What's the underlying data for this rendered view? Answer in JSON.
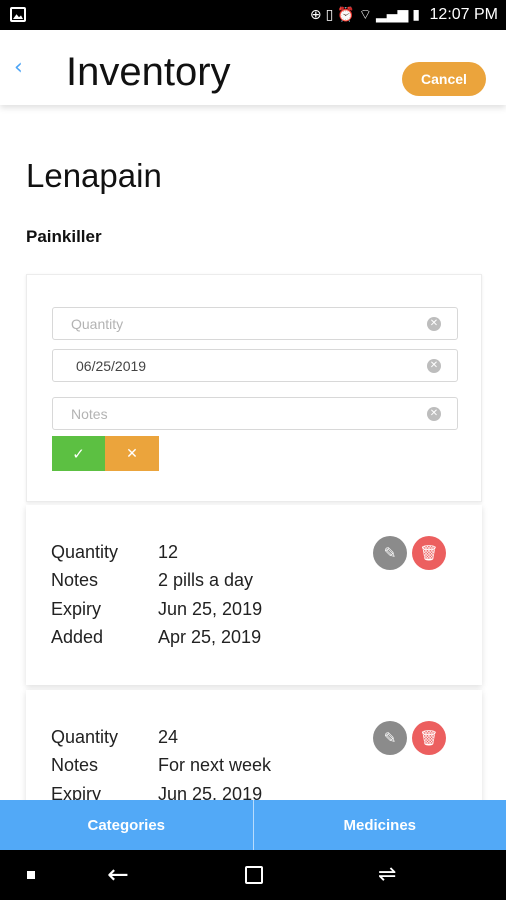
{
  "status_bar": {
    "time": "12:07 PM"
  },
  "header": {
    "title": "Inventory",
    "cancel_label": "Cancel"
  },
  "medicine": {
    "name": "Lenapain",
    "category": "Painkiller"
  },
  "form": {
    "quantity_placeholder": "Quantity",
    "date_value": "06/25/2019",
    "notes_placeholder": "Notes"
  },
  "labels": {
    "quantity": "Quantity",
    "notes": "Notes",
    "expiry": "Expiry",
    "added": "Added"
  },
  "entries": [
    {
      "quantity": "12",
      "notes": "2 pills a day",
      "expiry": "Jun 25, 2019",
      "added": "Apr 25, 2019"
    },
    {
      "quantity": "24",
      "notes": "For next week",
      "expiry": "Jun 25, 2019"
    }
  ],
  "tabs": [
    "Categories",
    "Medicines"
  ],
  "colors": {
    "accent_blue": "#52a9f7",
    "accent_orange": "#eba43c",
    "confirm_green": "#5cc042",
    "delete_red": "#ec5f5f",
    "edit_gray": "#8b8b8b"
  }
}
